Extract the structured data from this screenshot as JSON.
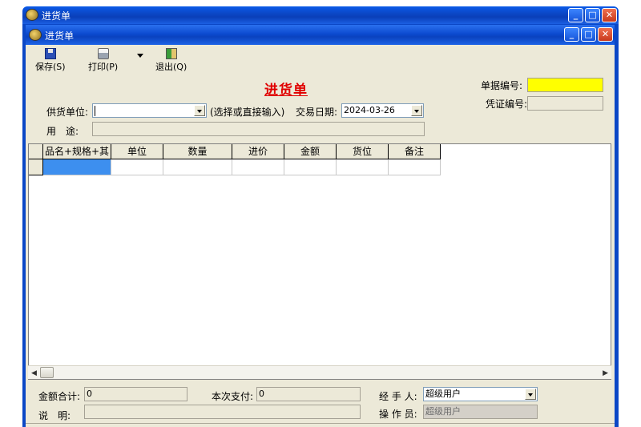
{
  "window": {
    "outer_title": "进货单",
    "inner_title": "进货单",
    "min_glyph": "_",
    "max_glyph": "□",
    "close_glyph": "✕"
  },
  "toolbar": {
    "save_label": "保存(S)",
    "print_label": "打印(P)",
    "exit_label": "退出(Q)"
  },
  "form": {
    "title": "进货单",
    "doc_no_label": "单据编号:",
    "doc_no_value": "",
    "voucher_no_label": "凭证编号:",
    "voucher_no_value": "",
    "supplier_label": "供货单位:",
    "supplier_value": "",
    "supplier_hint": "(选择或直接输入)",
    "date_label": "交易日期:",
    "date_value": "2024-03-26",
    "purpose_label": "用　途:",
    "purpose_value": ""
  },
  "grid": {
    "columns": [
      "品名+规格+其他",
      "单位",
      "数量",
      "进价",
      "金额",
      "货位",
      "备注"
    ]
  },
  "footer": {
    "total_label": "金额合计:",
    "total_value": "0",
    "paid_label": "本次支付:",
    "paid_value": "0",
    "handler_label": "经 手 人:",
    "handler_value": "超级用户",
    "note_label": "说　明:",
    "note_value": "",
    "operator_label": "操 作 员:",
    "operator_value": "超级用户"
  },
  "colors": {
    "title_red": "#e00000",
    "doc_no_bg": "#ffff00",
    "selected_cell": "#3d8fef"
  }
}
